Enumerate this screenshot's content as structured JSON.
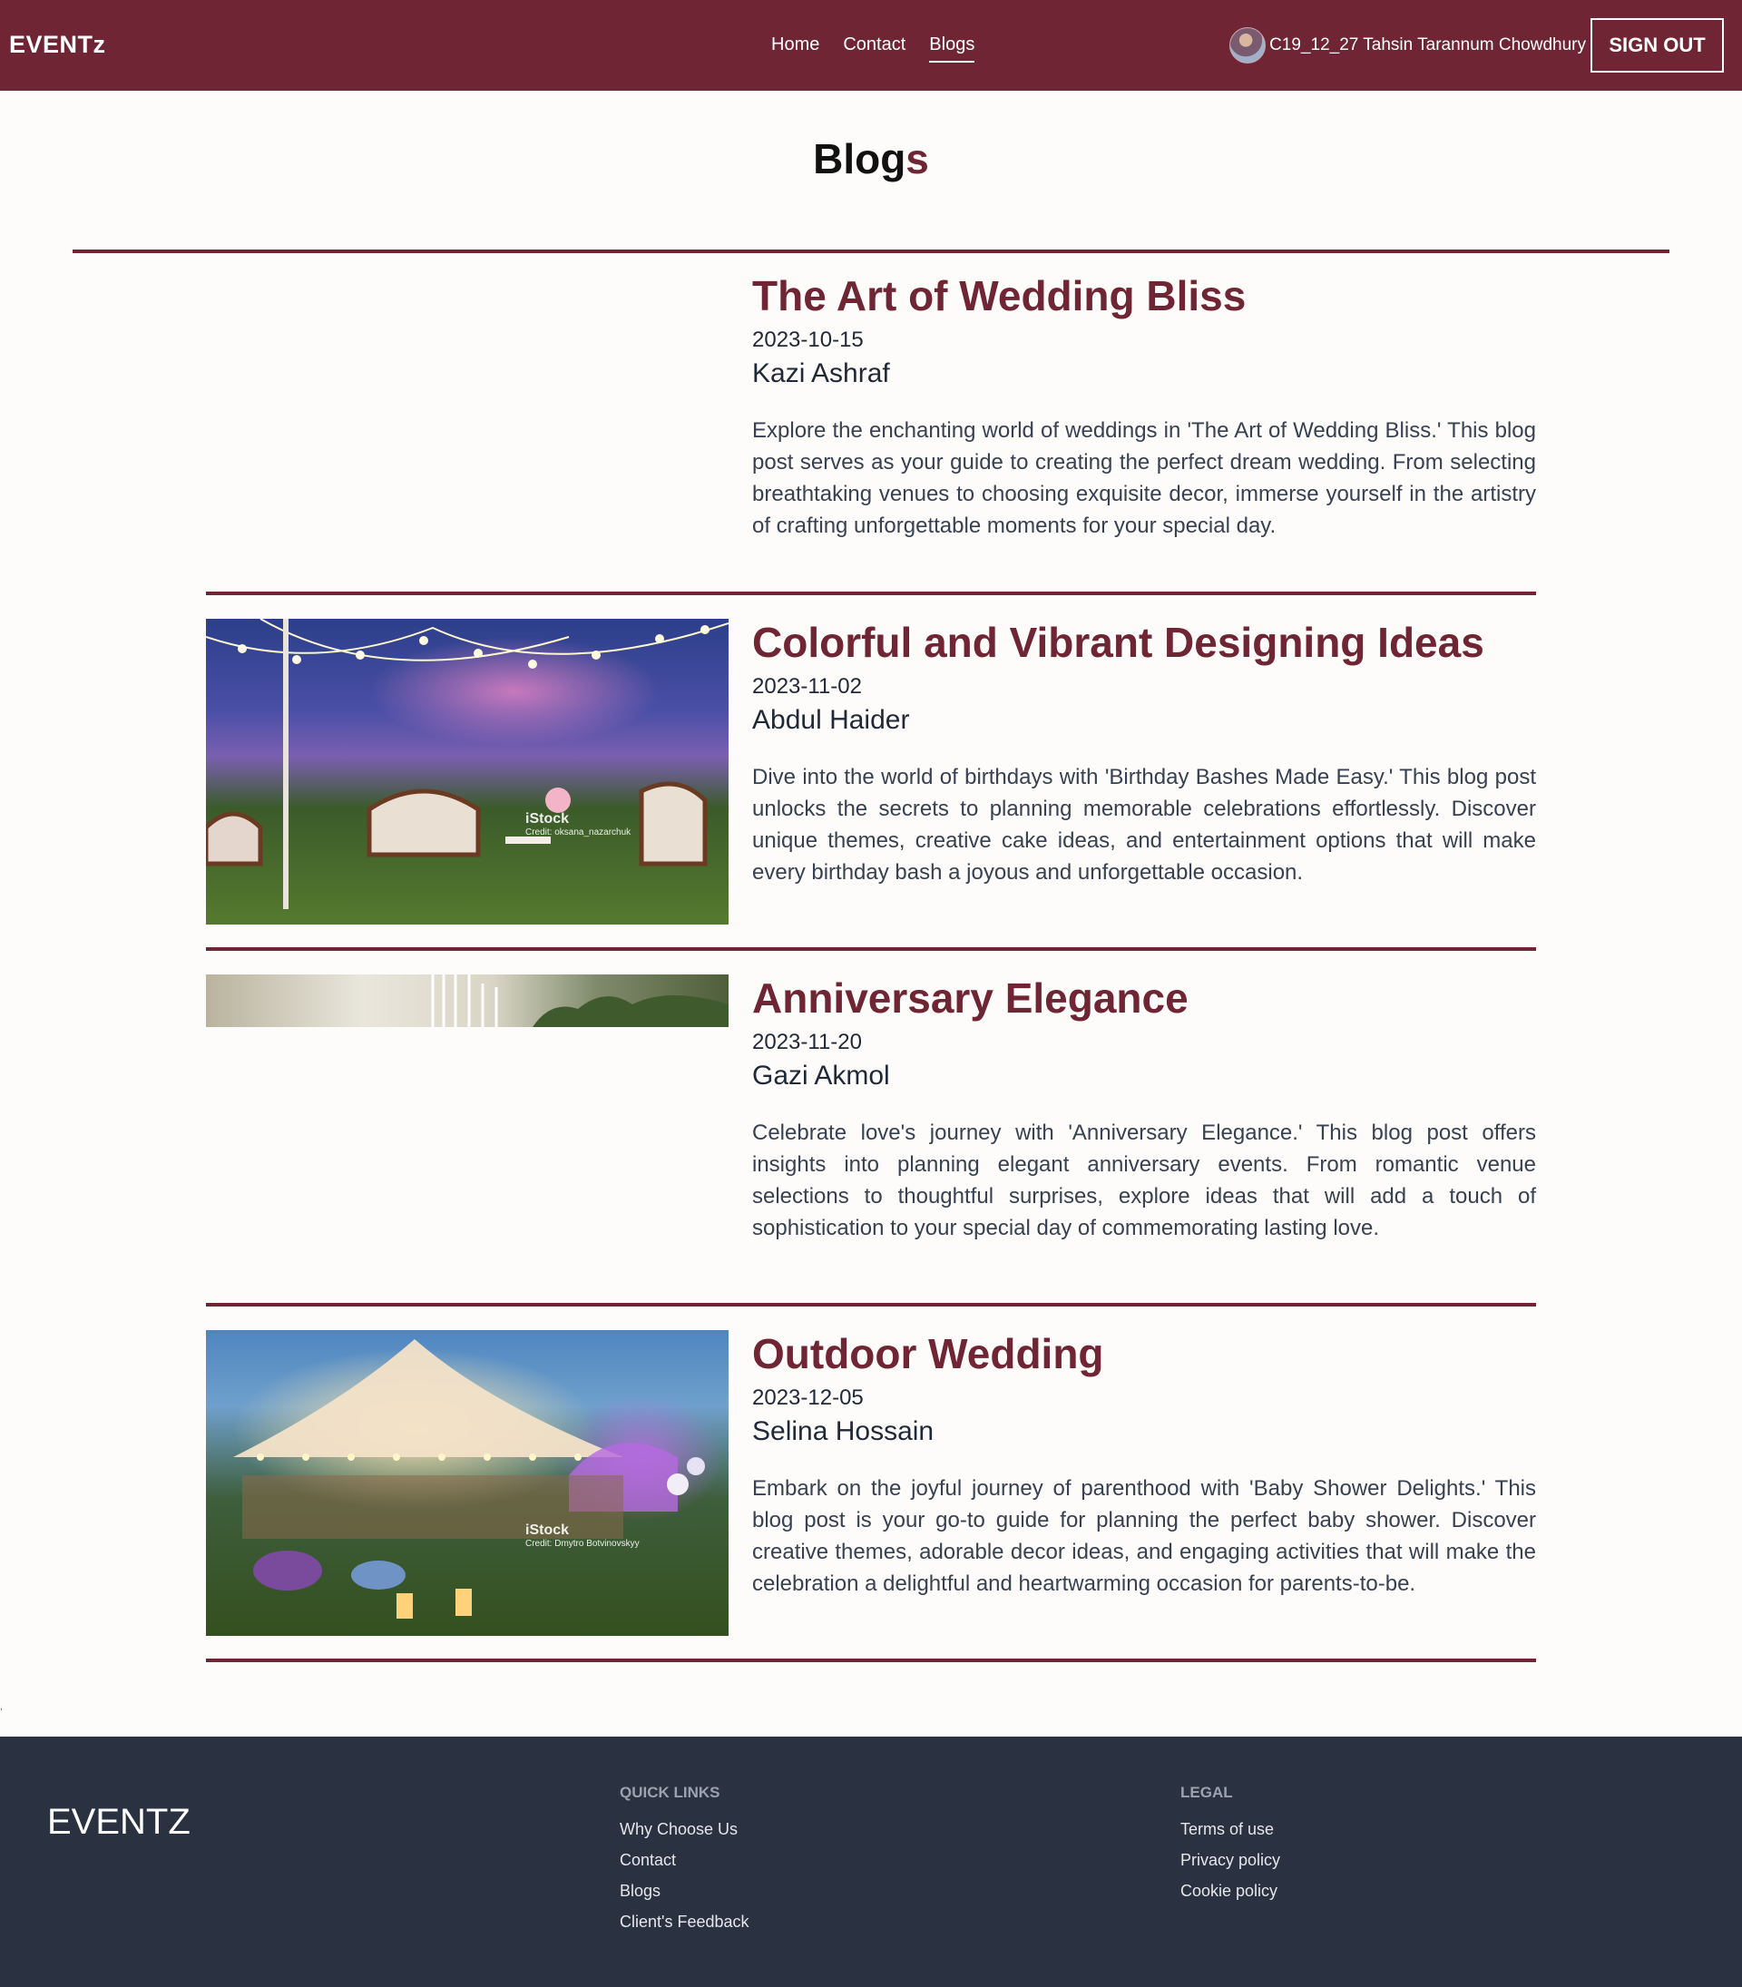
{
  "nav": {
    "brand": "EVENTz",
    "links": [
      "Home",
      "Contact",
      "Blogs"
    ],
    "active": "Blogs",
    "user_name": "C19_12_27 Tahsin Tarannum Chowdhury",
    "signout_label": "SIGN OUT"
  },
  "page": {
    "title_main": "Blog",
    "title_accent": "s"
  },
  "blogs": [
    {
      "title": "The Art of Wedding Bliss",
      "date": "2023-10-15",
      "author": "Kazi Ashraf",
      "excerpt": "Explore the enchanting world of weddings in 'The Art of Wedding Bliss.' This blog post serves as your guide to creating the perfect dream wedding. From selecting breathtaking venues to choosing exquisite decor, immerse yourself in the artistry of crafting unforgettable moments for your special day."
    },
    {
      "title": "Colorful and Vibrant Designing Ideas",
      "date": "2023-11-02",
      "author": "Abdul Haider",
      "excerpt": "Dive into the world of birthdays with 'Birthday Bashes Made Easy.' This blog post unlocks the secrets to planning memorable celebrations effortlessly. Discover unique themes, creative cake ideas, and entertainment options that will make every birthday bash a joyous and unforgettable occasion.",
      "image_watermark": "iStock",
      "image_credit": "Credit: oksana_nazarchuk"
    },
    {
      "title": "Anniversary Elegance",
      "date": "2023-11-20",
      "author": "Gazi Akmol",
      "excerpt": "Celebrate love's journey with 'Anniversary Elegance.' This blog post offers insights into planning elegant anniversary events. From romantic venue selections to thoughtful surprises, explore ideas that will add a touch of sophistication to your special day of commemorating lasting love."
    },
    {
      "title": "Outdoor Wedding",
      "date": "2023-12-05",
      "author": "Selina Hossain",
      "excerpt": "Embark on the joyful journey of parenthood with 'Baby Shower Delights.' This blog post is your go-to guide for planning the perfect baby shower. Discover creative themes, adorable decor ideas, and engaging activities that will make the celebration a delightful and heartwarming occasion for parents-to-be.",
      "image_watermark": "iStock",
      "image_credit": "Credit: Dmytro Botvinovskyy"
    }
  ],
  "stray_mark": ",",
  "footer": {
    "brand": "EVENTZ",
    "quick_links_heading": "QUICK LINKS",
    "quick_links": [
      "Why Choose Us",
      "Contact",
      "Blogs",
      "Client's Feedback"
    ],
    "legal_heading": "LEGAL",
    "legal_links": [
      "Terms of use",
      "Privacy policy",
      "Cookie policy"
    ]
  },
  "colors": {
    "primary": "#6f2533",
    "footer_bg": "#2a3140",
    "page_bg": "#fdfcfa"
  }
}
